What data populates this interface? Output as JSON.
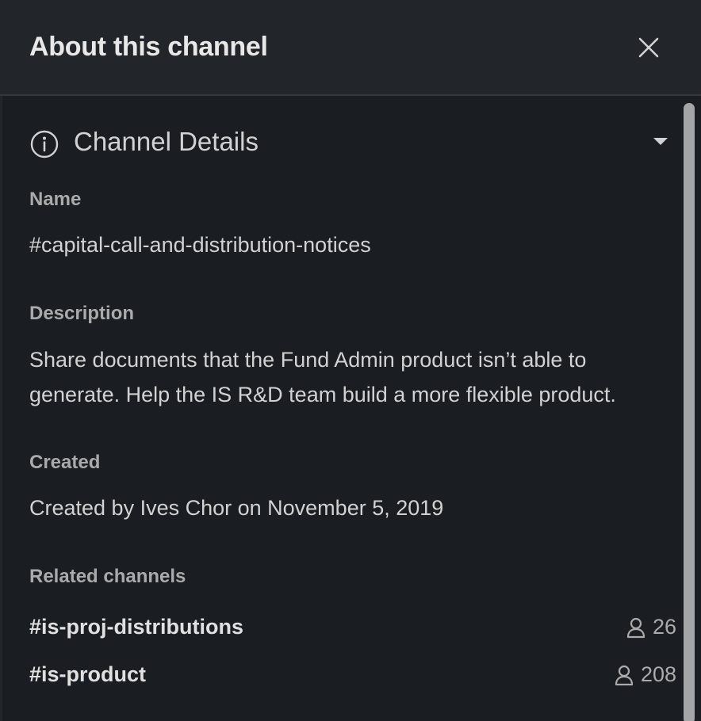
{
  "header": {
    "title": "About this channel",
    "close_icon": "close-icon"
  },
  "section": {
    "title": "Channel Details",
    "icon": "info-icon",
    "toggle_icon": "caret-down-icon"
  },
  "fields": {
    "name_label": "Name",
    "name_value": "#capital-call-and-distribution-notices",
    "description_label": "Description",
    "description_value": "Share documents that the Fund Admin product isn’t able to generate. Help the IS R&D team build a more flexible product.",
    "created_label": "Created",
    "created_value": "Created by Ives Chor on November 5, 2019"
  },
  "related": {
    "label": "Related channels",
    "channels": [
      {
        "name": "#is-proj-distributions",
        "members": "26"
      },
      {
        "name": "#is-product",
        "members": "208"
      }
    ]
  },
  "colors": {
    "background": "#1a1d21",
    "header_background": "#222529",
    "text": "#d1d2d3",
    "label": "#a9aaab",
    "scrollbar": "#a4a5a7"
  }
}
